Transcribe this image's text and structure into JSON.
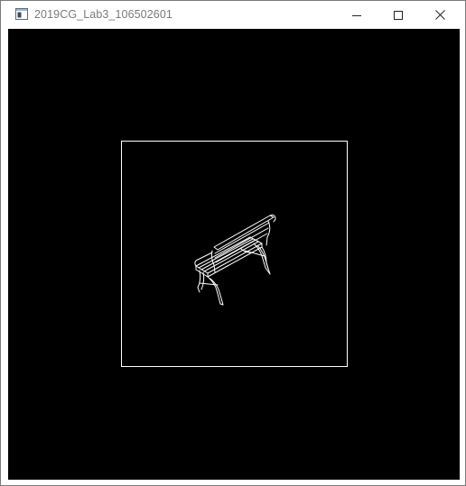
{
  "window": {
    "title": "2019CG_Lab3_106502601",
    "icon": "app-window-icon",
    "controls": {
      "minimize_icon": "minimize-icon",
      "maximize_icon": "maximize-icon",
      "close_icon": "close-icon"
    }
  },
  "scene": {
    "background_color": "#000000",
    "line_color": "#ffffff",
    "object_icon": "park-bench-wireframe"
  }
}
